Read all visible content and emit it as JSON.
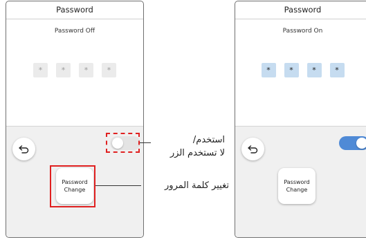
{
  "left_screen": {
    "title": "Password",
    "status_text": "Password Off",
    "pin_chars": [
      "*",
      "*",
      "*",
      "*"
    ],
    "change_button": {
      "line1": "Password",
      "line2": "Change"
    },
    "toggle_state": "off"
  },
  "right_screen": {
    "title": "Password",
    "status_text": "Password On",
    "pin_chars": [
      "*",
      "*",
      "*",
      "*"
    ],
    "change_button": {
      "line1": "Password",
      "line2": "Change"
    },
    "toggle_state": "on"
  },
  "callouts": {
    "toggle_line1": "استخدم/",
    "toggle_line2": "لا تستخدم الزر",
    "change": "تغيير كلمة المرور"
  },
  "icons": {
    "back": "back-arrow-icon"
  },
  "colors": {
    "highlight": "#e02020",
    "pin_on": "#c6dcf0",
    "pin_off": "#ebebeb",
    "toggle_on": "#4f8ad6",
    "toggle_off": "#e4e4e4"
  }
}
